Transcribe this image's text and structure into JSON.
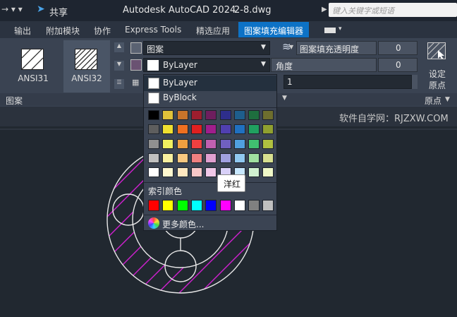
{
  "titlebar": {
    "share_label": "共享",
    "app_title": "Autodesk AutoCAD 2024",
    "file_name": "2-8.dwg",
    "search_placeholder": "键入关键字或短语"
  },
  "tabs": [
    {
      "label": "输出"
    },
    {
      "label": "附加模块"
    },
    {
      "label": "协作"
    },
    {
      "label": "Express Tools"
    },
    {
      "label": "精选应用"
    },
    {
      "label": "图案填充编辑器",
      "active": true
    }
  ],
  "ribbon": {
    "patterns": [
      {
        "label": "ANSI31"
      },
      {
        "label": "ANSI32"
      }
    ],
    "pattern_panel_label": "图案",
    "type_value": "图案",
    "color_value": "ByLayer",
    "transparency_label": "图案填充透明度",
    "transparency_value": "0",
    "angle_label": "角度",
    "angle_value": "0",
    "scale_value": "1",
    "set_origin_label_1": "设定",
    "set_origin_label_2": "原点",
    "origin_panel_label": "原点"
  },
  "dropdown": {
    "options": [
      {
        "label": "ByLayer",
        "selected": true
      },
      {
        "label": "ByBlock"
      }
    ],
    "palette_rows": [
      [
        "#000000",
        "#e0c23a",
        "#c8742a",
        "#9e1e2e",
        "#6e1e5e",
        "#2e2e8c",
        "#1e5e8c",
        "#1e6e3e",
        "#6e6e2e"
      ],
      [
        "#5e5e5e",
        "#f0e030",
        "#f07020",
        "#e02020",
        "#a01e8c",
        "#5040b0",
        "#2070c0",
        "#20a060",
        "#90a030"
      ],
      [
        "#909090",
        "#f0f060",
        "#f0a040",
        "#f04040",
        "#c060b0",
        "#7060c0",
        "#50a0e0",
        "#40c070",
        "#b0c040"
      ],
      [
        "#c0c0c0",
        "#f8f0a0",
        "#f8c880",
        "#f08080",
        "#e0a0d0",
        "#a0a0e0",
        "#90c8f0",
        "#a0e0a0",
        "#d8e090"
      ],
      [
        "#ffffff",
        "#fff8d0",
        "#ffe8c0",
        "#f8c8c8",
        "#f0c8e8",
        "#d8d0f8",
        "#c8e8ff",
        "#d0f0d0",
        "#f0f8c8"
      ]
    ],
    "index_label": "索引颜色",
    "index_colors": [
      "#ff0000",
      "#ffff00",
      "#00ff00",
      "#00ffff",
      "#0000ff",
      "#ff00ff",
      "#ffffff",
      "#808080",
      "#c0c0c0"
    ],
    "more_colors_label": "更多颜色..."
  },
  "tooltip_text": "洋红",
  "watermark": "软件自学网：RJZXW.COM"
}
